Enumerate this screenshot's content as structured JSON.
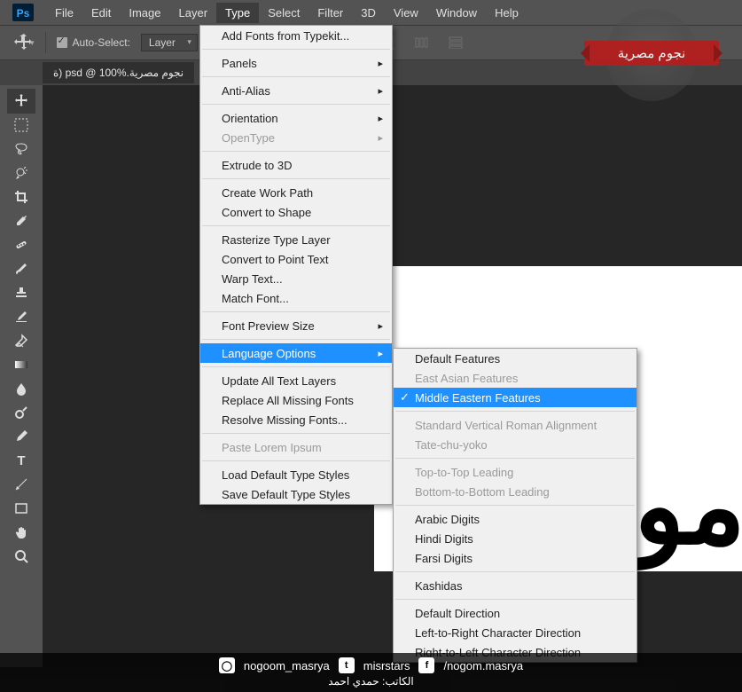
{
  "menubar": [
    "File",
    "Edit",
    "Image",
    "Layer",
    "Type",
    "Select",
    "Filter",
    "3D",
    "View",
    "Window",
    "Help"
  ],
  "activeMenu": "Type",
  "optbar": {
    "autoselect_label": "Auto-Select:",
    "autoselect_value": "Layer"
  },
  "doctab": "نجوم مصرية.psd @ 100% (ة",
  "typeMenu": [
    {
      "label": "Add Fonts from Typekit...",
      "type": "item"
    },
    {
      "type": "sep"
    },
    {
      "label": "Panels",
      "type": "sub"
    },
    {
      "type": "sep"
    },
    {
      "label": "Anti-Alias",
      "type": "sub"
    },
    {
      "type": "sep"
    },
    {
      "label": "Orientation",
      "type": "sub"
    },
    {
      "label": "OpenType",
      "type": "sub",
      "disabled": true
    },
    {
      "type": "sep"
    },
    {
      "label": "Extrude to 3D",
      "type": "item"
    },
    {
      "type": "sep"
    },
    {
      "label": "Create Work Path",
      "type": "item"
    },
    {
      "label": "Convert to Shape",
      "type": "item"
    },
    {
      "type": "sep"
    },
    {
      "label": "Rasterize Type Layer",
      "type": "item"
    },
    {
      "label": "Convert to Point Text",
      "type": "item"
    },
    {
      "label": "Warp Text...",
      "type": "item"
    },
    {
      "label": "Match Font...",
      "type": "item"
    },
    {
      "type": "sep"
    },
    {
      "label": "Font Preview Size",
      "type": "sub"
    },
    {
      "type": "sep"
    },
    {
      "label": "Language Options",
      "type": "sub",
      "highlight": true
    },
    {
      "type": "sep"
    },
    {
      "label": "Update All Text Layers",
      "type": "item"
    },
    {
      "label": "Replace All Missing Fonts",
      "type": "item"
    },
    {
      "label": "Resolve Missing Fonts...",
      "type": "item"
    },
    {
      "type": "sep"
    },
    {
      "label": "Paste Lorem Ipsum",
      "type": "item",
      "disabled": true
    },
    {
      "type": "sep"
    },
    {
      "label": "Load Default Type Styles",
      "type": "item"
    },
    {
      "label": "Save Default Type Styles",
      "type": "item"
    }
  ],
  "langMenu": [
    {
      "label": "Default Features",
      "type": "item"
    },
    {
      "label": "East Asian Features",
      "type": "item",
      "disabled": true
    },
    {
      "label": "Middle Eastern Features",
      "type": "item",
      "highlight": true,
      "checked": true
    },
    {
      "type": "sep"
    },
    {
      "label": "Standard Vertical Roman Alignment",
      "type": "item",
      "disabled": true
    },
    {
      "label": "Tate-chu-yoko",
      "type": "item",
      "disabled": true
    },
    {
      "type": "sep"
    },
    {
      "label": "Top-to-Top Leading",
      "type": "item",
      "disabled": true
    },
    {
      "label": "Bottom-to-Bottom Leading",
      "type": "item",
      "disabled": true
    },
    {
      "type": "sep"
    },
    {
      "label": "Arabic Digits",
      "type": "item"
    },
    {
      "label": "Hindi Digits",
      "type": "item"
    },
    {
      "label": "Farsi Digits",
      "type": "item"
    },
    {
      "type": "sep"
    },
    {
      "label": "Kashidas",
      "type": "item"
    },
    {
      "type": "sep"
    },
    {
      "label": "Default Direction",
      "type": "item"
    },
    {
      "label": "Left-to-Right Character Direction",
      "type": "item"
    },
    {
      "label": "Right-to-Left Character Direction",
      "type": "item"
    }
  ],
  "tools": [
    "move",
    "marquee",
    "lasso",
    "quickselect",
    "crop",
    "eyedropper",
    "healing",
    "brush",
    "stamp",
    "history",
    "eraser",
    "gradient",
    "blur",
    "dodge",
    "pen",
    "type",
    "path",
    "rectangle",
    "hand",
    "zoom"
  ],
  "canvas_glyph": "مو",
  "footer": {
    "instagram": "nogoom_masrya",
    "twitter": "misrstars",
    "facebook": "/nogom.masrya",
    "credit": "الكاتب: حمدي احمد"
  },
  "badge_text": "نجوم مصرية"
}
